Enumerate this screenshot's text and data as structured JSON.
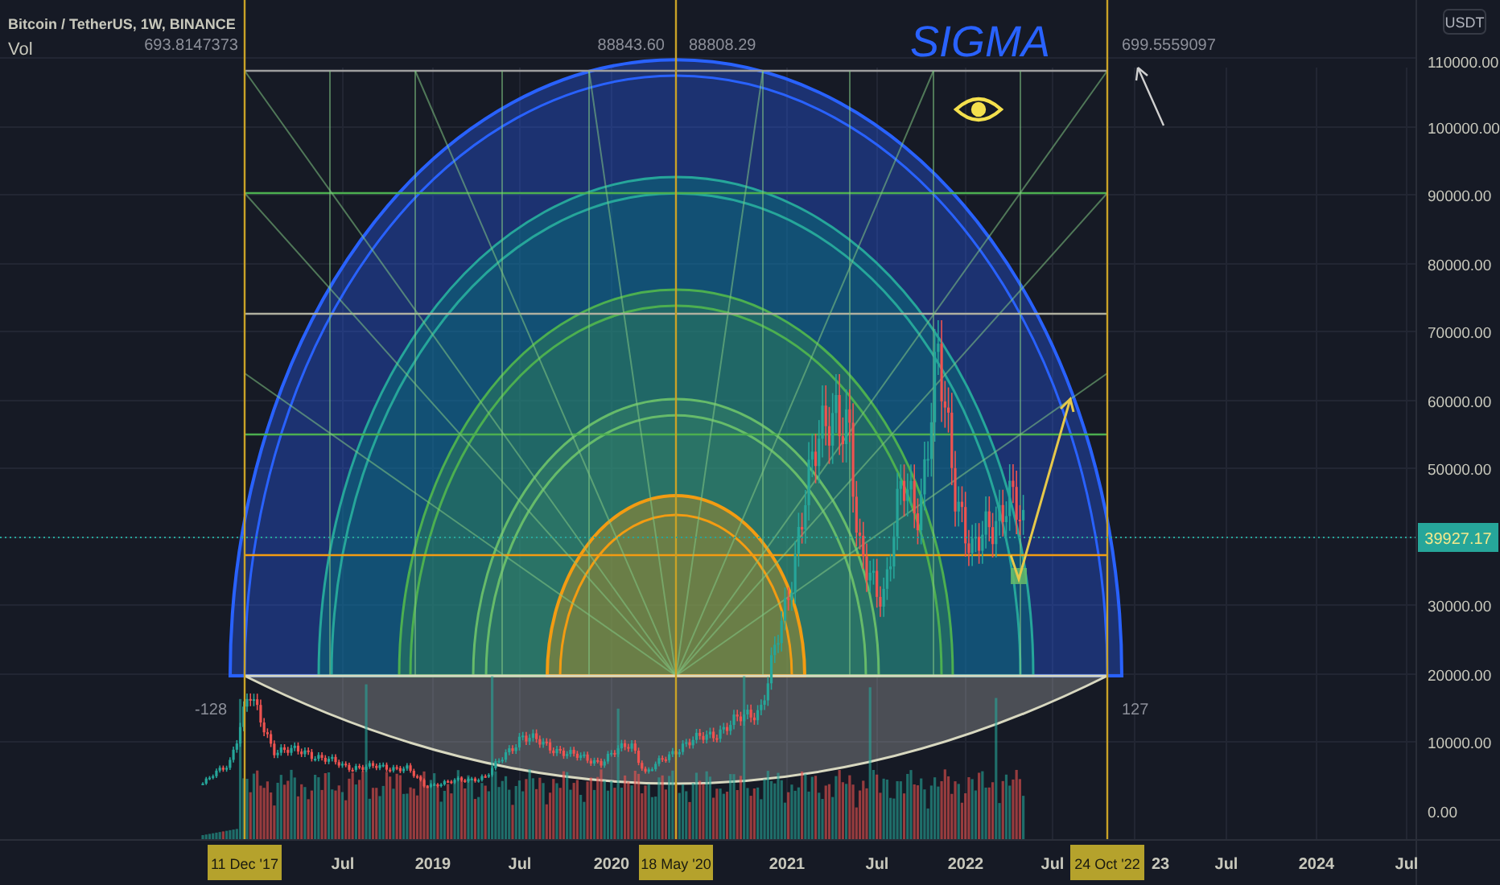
{
  "legend": {
    "symbol": "Bitcoin / TetherUS, 1W, BINANCE",
    "volume": "Vol"
  },
  "drawing_labels": [
    "693.8147373",
    "88843.60",
    "88808.29",
    "699.5559097",
    "-128",
    "127"
  ],
  "title_text": "SIGMA",
  "price_scale": {
    "currency": "USDT",
    "ticks": [
      "110000.00",
      "100000.00",
      "90000.00",
      "80000.00",
      "70000.00",
      "60000.00",
      "50000.00",
      "30000.00",
      "20000.00",
      "10000.00",
      "0.00"
    ],
    "last_price": "39927.17"
  },
  "time_scale": {
    "ticks": [
      {
        "label": "11 Dec '17",
        "highlighted": true
      },
      {
        "label": "Jul",
        "highlighted": false
      },
      {
        "label": "2019",
        "highlighted": false
      },
      {
        "label": "Jul",
        "highlighted": false
      },
      {
        "label": "2020",
        "highlighted": false
      },
      {
        "label": "18 May '20",
        "highlighted": true
      },
      {
        "label": "2021",
        "highlighted": false
      },
      {
        "label": "Jul",
        "highlighted": false
      },
      {
        "label": "2022",
        "highlighted": false
      },
      {
        "label": "Jul",
        "highlighted": false
      },
      {
        "label": "24 Oct '22",
        "highlighted": true
      },
      {
        "label": "23",
        "highlighted": false
      },
      {
        "label": "Jul",
        "highlighted": false
      },
      {
        "label": "2024",
        "highlighted": false
      },
      {
        "label": "Jul",
        "highlighted": false
      }
    ]
  }
}
